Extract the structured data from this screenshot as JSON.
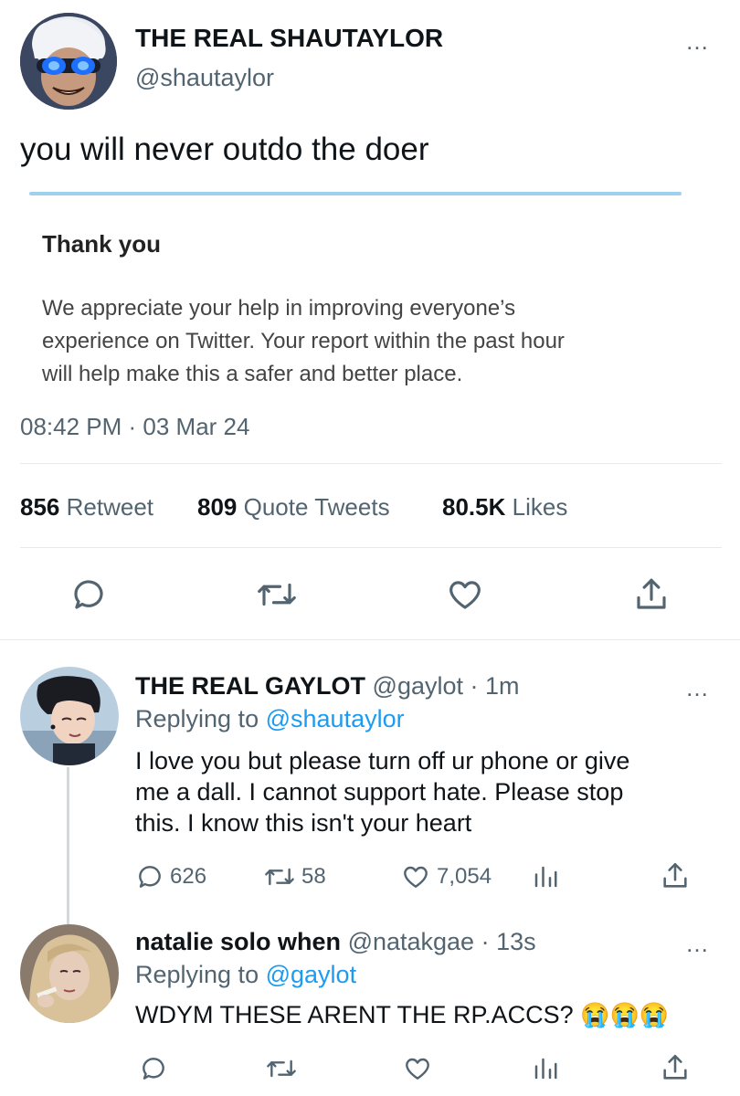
{
  "main_tweet": {
    "display_name": "THE REAL SHAUTAYLOR",
    "handle": "@shautaylor",
    "more_icon": "…",
    "text": "you will never outdo the doer",
    "embedded_image": {
      "heading": "Thank you",
      "body_lines": [
        "We appreciate your help in improving everyone’s",
        "experience on Twitter. Your report within the past hour",
        "will help make this a safer and better place."
      ]
    },
    "timestamp": "08:42 PM · 03 Mar 24",
    "stats": {
      "retweets_count": "856",
      "retweets_label": "Retweet",
      "quotes_count": "809",
      "quotes_label": "Quote Tweets",
      "likes_count": "80.5K",
      "likes_label": "Likes"
    }
  },
  "replies": [
    {
      "display_name": "THE REAL GAYLOT",
      "handle": "@gaylot",
      "time": "· 1m",
      "replying_prefix": "Replying to",
      "replying_to": "@shautaylor",
      "text_lines": [
        "I love you but please turn off ur phone or give",
        "me a dall. I cannot support hate. Please stop",
        "this. I know this isn't your heart"
      ],
      "replies_count": "626",
      "retweets_count": "58",
      "likes_count": "7,054"
    },
    {
      "display_name": "natalie solo when",
      "handle": "@natakgae",
      "time": "· 13s",
      "replying_prefix": "Replying to",
      "replying_to": "@gaylot",
      "text": "WDYM THESE ARENT THE RP.ACCS?",
      "emoji": "😭😭😭"
    }
  ],
  "colors": {
    "link": "#1d9bf0",
    "muted": "#536471",
    "text": "#0f1419",
    "divider": "#e7e9ea"
  }
}
